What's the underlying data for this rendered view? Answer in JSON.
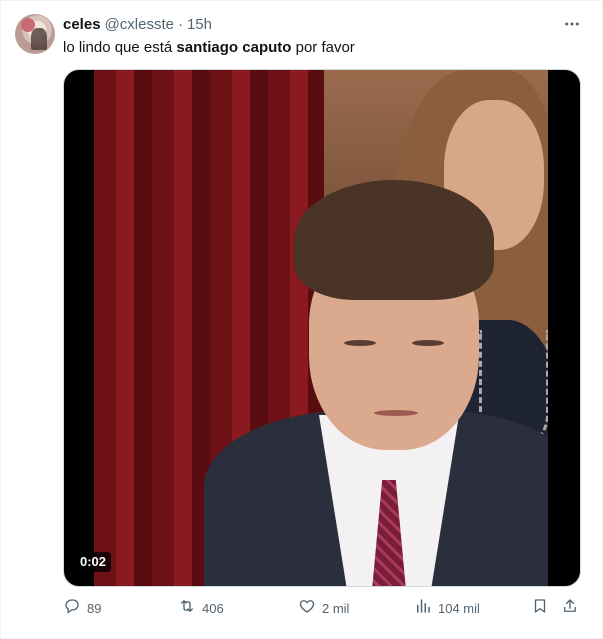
{
  "tweet": {
    "author_name": "celes",
    "handle": "@cxlesste",
    "separator": "·",
    "time": "15h",
    "text_before": "lo lindo que está ",
    "text_bold": "santiago caputo",
    "text_after": " por favor",
    "video_duration": "0:02",
    "icons": {
      "more": "more-dots-icon",
      "reply": "reply-icon",
      "retweet": "retweet-icon",
      "like": "heart-icon",
      "views": "bar-chart-icon",
      "bookmark": "bookmark-icon",
      "share": "share-icon"
    }
  },
  "actions": {
    "replies": "89",
    "retweets": "406",
    "likes": "2 mil",
    "views": "104 mil"
  },
  "colors": {
    "text_primary": "#0f1419",
    "text_secondary": "#536471",
    "border": "#eff3f4"
  }
}
